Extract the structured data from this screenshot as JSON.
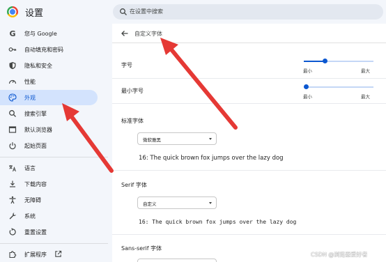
{
  "app": {
    "title": "设置"
  },
  "search": {
    "placeholder": "在设置中搜索"
  },
  "sidebar": {
    "items": [
      {
        "label": "您与 Google",
        "icon": "google-g-icon"
      },
      {
        "label": "自动填充和密码",
        "icon": "key-icon"
      },
      {
        "label": "隐私和安全",
        "icon": "shield-icon"
      },
      {
        "label": "性能",
        "icon": "speedometer-icon"
      },
      {
        "label": "外观",
        "icon": "palette-icon",
        "active": true
      },
      {
        "label": "搜索引擎",
        "icon": "search-icon"
      },
      {
        "label": "默认浏览器",
        "icon": "browser-window-icon"
      },
      {
        "label": "起始页面",
        "icon": "power-icon"
      },
      {
        "label": "语言",
        "icon": "translate-icon"
      },
      {
        "label": "下载内容",
        "icon": "download-icon"
      },
      {
        "label": "无障碍",
        "icon": "accessibility-icon"
      },
      {
        "label": "系统",
        "icon": "wrench-icon"
      },
      {
        "label": "重置设置",
        "icon": "reset-icon"
      },
      {
        "label": "扩展程序",
        "icon": "extension-puzzle-icon",
        "external": true
      }
    ]
  },
  "main": {
    "title": "自定义字体",
    "font_size": {
      "label": "字号",
      "min_label": "最小",
      "max_label": "最大",
      "level": 0.3
    },
    "min_font_size": {
      "label": "最小字号",
      "min_label": "最小",
      "max_label": "最大",
      "level": 0.0
    },
    "standard_font": {
      "label": "标准字体",
      "selected": "微软雅黑",
      "preview": "16: The quick brown fox jumps over the lazy dog"
    },
    "serif_font": {
      "label": "Serif 字体",
      "selected": "自定义",
      "preview": "16: The quick brown fox jumps over the lazy dog"
    },
    "sans_serif_font": {
      "label": "Sans-serif 字体"
    }
  },
  "watermark": "CSDN @浏览器爱好者",
  "colors": {
    "accent": "#0b57d0",
    "active_bg": "#d3e3fd",
    "annotation_arrow": "#e53935"
  }
}
